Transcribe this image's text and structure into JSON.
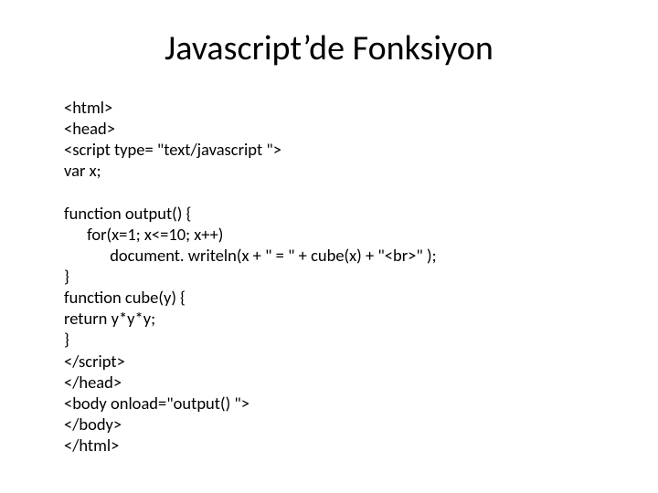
{
  "title": "Javascript’de Fonksiyon",
  "code": "<html>\n<head>\n<script type= \"text/javascript \">\nvar x;\n\nfunction output() {\n      for(x=1; x<=10; x++)\n            document. writeln(x + \" = \" + cube(x) + \"<br>\" );\n}\nfunction cube(y) {\nreturn y*y*y;\n}\n</script>\n</head>\n<body onload=\"output() \">\n</body>\n</html>"
}
